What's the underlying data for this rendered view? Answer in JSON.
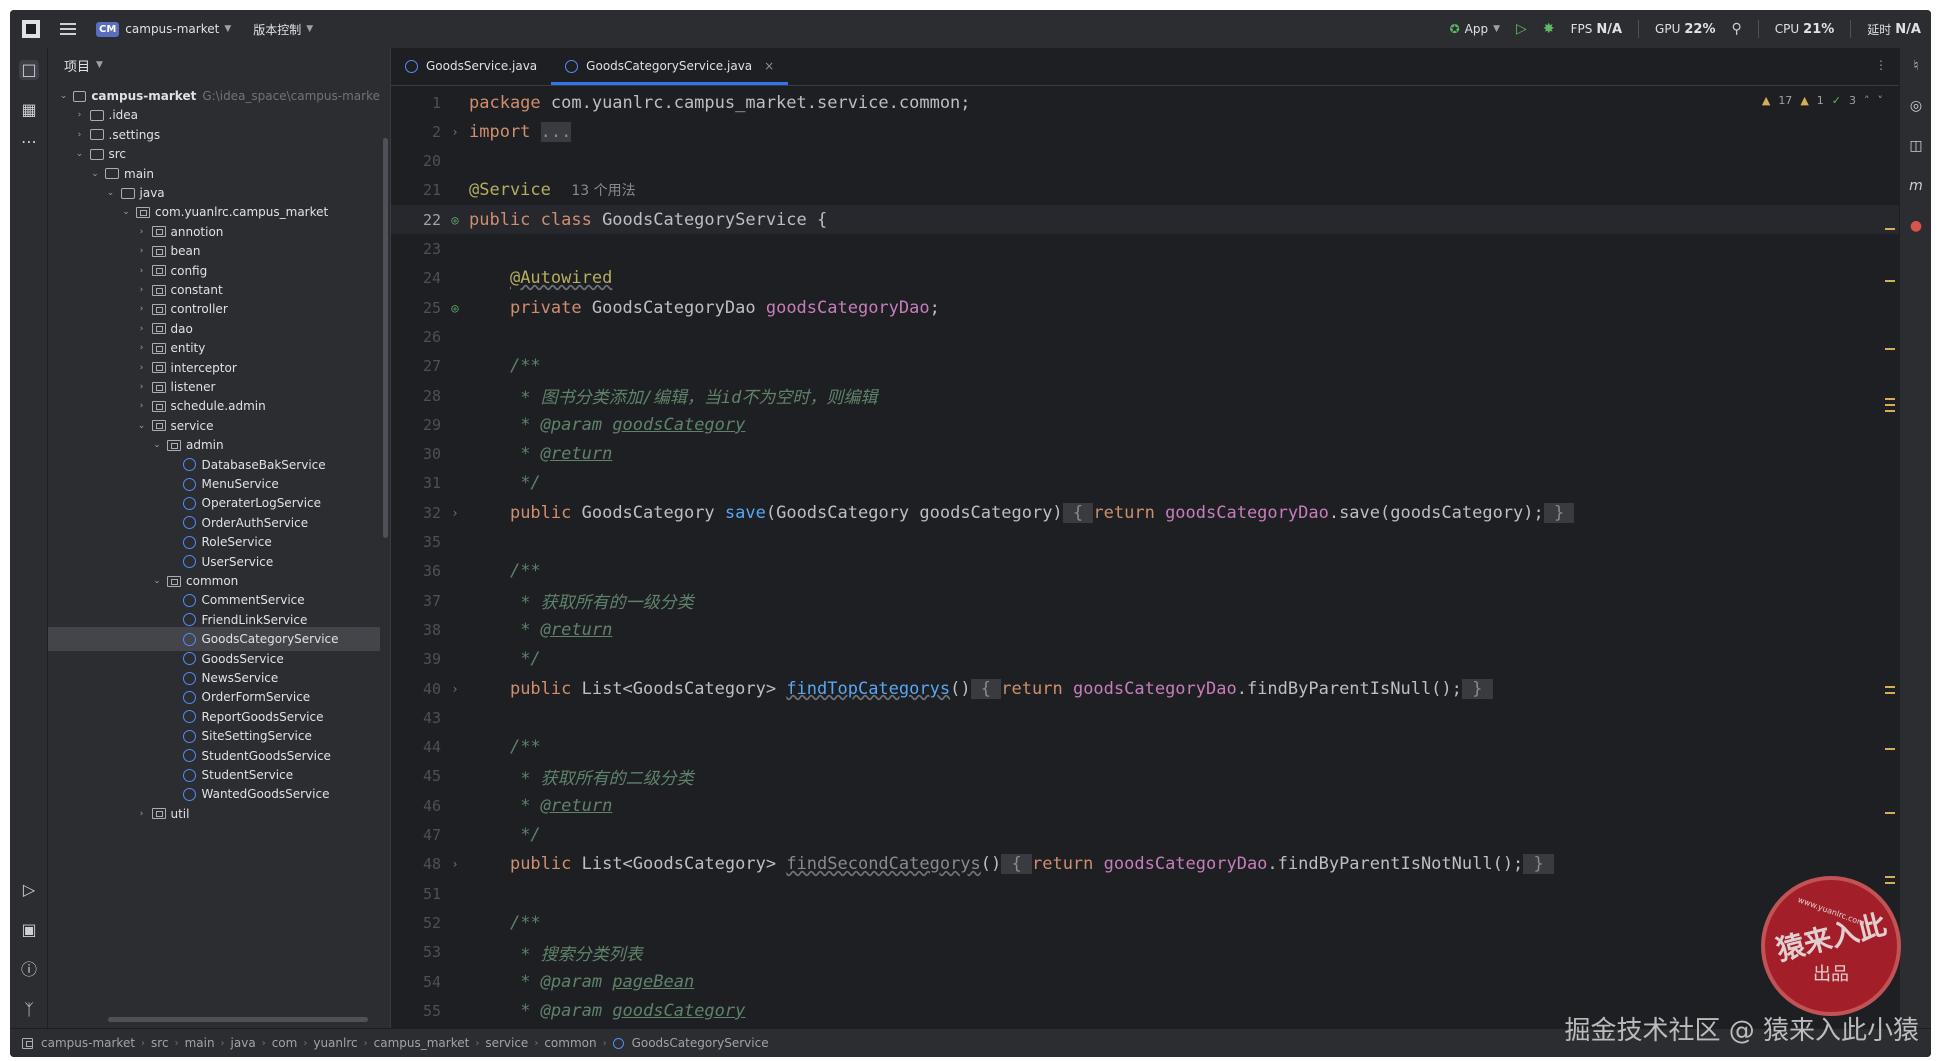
{
  "titlebar": {
    "project_badge": "CM",
    "project_name": "campus-market",
    "vcs": "版本控制",
    "run_config": "App",
    "fps_label": "FPS",
    "fps_value": "N/A",
    "gpu_label": "GPU",
    "gpu_value": "22%",
    "cpu_label": "CPU",
    "cpu_value": "21%",
    "time_label": "延时",
    "time_value": "N/A"
  },
  "project_panel": {
    "header": "项目",
    "root_path": "G:\\idea_space\\campus-marke",
    "tree": [
      {
        "label": "campus-market",
        "depth": 0,
        "type": "module",
        "arrow": "down",
        "bold": true
      },
      {
        "label": ".idea",
        "depth": 1,
        "type": "folder",
        "arrow": "right"
      },
      {
        "label": ".settings",
        "depth": 1,
        "type": "folder",
        "arrow": "right"
      },
      {
        "label": "src",
        "depth": 1,
        "type": "folder",
        "arrow": "down"
      },
      {
        "label": "main",
        "depth": 2,
        "type": "folder",
        "arrow": "down"
      },
      {
        "label": "java",
        "depth": 3,
        "type": "folder",
        "arrow": "down"
      },
      {
        "label": "com.yuanlrc.campus_market",
        "depth": 4,
        "type": "pkg",
        "arrow": "down"
      },
      {
        "label": "annotion",
        "depth": 5,
        "type": "pkg",
        "arrow": "right"
      },
      {
        "label": "bean",
        "depth": 5,
        "type": "pkg",
        "arrow": "right"
      },
      {
        "label": "config",
        "depth": 5,
        "type": "pkg",
        "arrow": "right"
      },
      {
        "label": "constant",
        "depth": 5,
        "type": "pkg",
        "arrow": "right"
      },
      {
        "label": "controller",
        "depth": 5,
        "type": "pkg",
        "arrow": "right"
      },
      {
        "label": "dao",
        "depth": 5,
        "type": "pkg",
        "arrow": "right"
      },
      {
        "label": "entity",
        "depth": 5,
        "type": "pkg",
        "arrow": "right"
      },
      {
        "label": "interceptor",
        "depth": 5,
        "type": "pkg",
        "arrow": "right"
      },
      {
        "label": "listener",
        "depth": 5,
        "type": "pkg",
        "arrow": "right"
      },
      {
        "label": "schedule.admin",
        "depth": 5,
        "type": "pkg",
        "arrow": "right"
      },
      {
        "label": "service",
        "depth": 5,
        "type": "pkg",
        "arrow": "down"
      },
      {
        "label": "admin",
        "depth": 6,
        "type": "pkg",
        "arrow": "down"
      },
      {
        "label": "DatabaseBakService",
        "depth": 7,
        "type": "class"
      },
      {
        "label": "MenuService",
        "depth": 7,
        "type": "class"
      },
      {
        "label": "OperaterLogService",
        "depth": 7,
        "type": "class"
      },
      {
        "label": "OrderAuthService",
        "depth": 7,
        "type": "class"
      },
      {
        "label": "RoleService",
        "depth": 7,
        "type": "class"
      },
      {
        "label": "UserService",
        "depth": 7,
        "type": "class"
      },
      {
        "label": "common",
        "depth": 6,
        "type": "pkg",
        "arrow": "down"
      },
      {
        "label": "CommentService",
        "depth": 7,
        "type": "class"
      },
      {
        "label": "FriendLinkService",
        "depth": 7,
        "type": "class"
      },
      {
        "label": "GoodsCategoryService",
        "depth": 7,
        "type": "class",
        "selected": true
      },
      {
        "label": "GoodsService",
        "depth": 7,
        "type": "class"
      },
      {
        "label": "NewsService",
        "depth": 7,
        "type": "class"
      },
      {
        "label": "OrderFormService",
        "depth": 7,
        "type": "class"
      },
      {
        "label": "ReportGoodsService",
        "depth": 7,
        "type": "class"
      },
      {
        "label": "SiteSettingService",
        "depth": 7,
        "type": "class"
      },
      {
        "label": "StudentGoodsService",
        "depth": 7,
        "type": "class"
      },
      {
        "label": "StudentService",
        "depth": 7,
        "type": "class"
      },
      {
        "label": "WantedGoodsService",
        "depth": 7,
        "type": "class"
      },
      {
        "label": "util",
        "depth": 5,
        "type": "pkg",
        "arrow": "right"
      }
    ]
  },
  "tabs": [
    {
      "label": "GoodsService.java",
      "active": false
    },
    {
      "label": "GoodsCategoryService.java",
      "active": true
    }
  ],
  "inspections": {
    "warnings": "17",
    "weak": "1",
    "ok": "3"
  },
  "code_lines": [
    {
      "n": "1",
      "html": "<span class='kw'>package</span> com.yuanlrc.campus_market.service.common;"
    },
    {
      "n": "2",
      "html": "<span class='kw'>import</span> <span class='fold'>...</span>",
      "fold": true
    },
    {
      "n": "20",
      "html": ""
    },
    {
      "n": "21",
      "html": "<span class='ann'>@Service</span>  <span class='usage'>13 个用法</span>"
    },
    {
      "n": "22",
      "html": "<span class='kw'>public class</span> GoodsCategoryService {",
      "cur": true,
      "bean": true
    },
    {
      "n": "23",
      "html": ""
    },
    {
      "n": "24",
      "html": "    <span class='ann ul'>@Autowired</span>"
    },
    {
      "n": "25",
      "html": "    <span class='kw'>private</span> GoodsCategoryDao <span class='fld'>goodsCategoryDao</span>;",
      "bean": true
    },
    {
      "n": "26",
      "html": ""
    },
    {
      "n": "27",
      "html": "    <span class='cmt'>/**</span>"
    },
    {
      "n": "28",
      "html": "     <span class='cmt'>* 图书分类添加/编辑，当id不为空时，则编辑</span>"
    },
    {
      "n": "29",
      "html": "     <span class='cmt'>* @param <span class='tag'>goodsCategory</span></span>"
    },
    {
      "n": "30",
      "html": "     <span class='cmt'>* <span class='tag'>@return</span></span>"
    },
    {
      "n": "31",
      "html": "     <span class='cmt'>*/</span>"
    },
    {
      "n": "32",
      "html": "    <span class='kw'>public</span> GoodsCategory <span class='mth'>save</span>(GoodsCategory goodsCategory)<span class='fold'> { </span><span class='kw'>return</span> <span class='fld'>goodsCategoryDao</span>.save(goodsCategory);<span class='fold'> } </span>",
      "fold": true
    },
    {
      "n": "35",
      "html": ""
    },
    {
      "n": "36",
      "html": "    <span class='cmt'>/**</span>"
    },
    {
      "n": "37",
      "html": "     <span class='cmt'>* 获取所有的一级分类</span>"
    },
    {
      "n": "38",
      "html": "     <span class='cmt'>* <span class='tag'>@return</span></span>"
    },
    {
      "n": "39",
      "html": "     <span class='cmt'>*/</span>"
    },
    {
      "n": "40",
      "html": "    <span class='kw'>public</span> List&lt;GoodsCategory&gt; <span class='mth ul'>findTopCategorys</span>()<span class='fold'> { </span><span class='kw'>return</span> <span class='fld'>goodsCategoryDao</span>.findByParentIsNull();<span class='fold'> } </span>",
      "fold": true
    },
    {
      "n": "43",
      "html": ""
    },
    {
      "n": "44",
      "html": "    <span class='cmt'>/**</span>"
    },
    {
      "n": "45",
      "html": "     <span class='cmt'>* 获取所有的二级分类</span>"
    },
    {
      "n": "46",
      "html": "     <span class='cmt'>* <span class='tag'>@return</span></span>"
    },
    {
      "n": "47",
      "html": "     <span class='cmt'>*/</span>"
    },
    {
      "n": "48",
      "html": "    <span class='kw'>public</span> List&lt;GoodsCategory&gt; <span class='grey ul'>findSecondCategorys</span>()<span class='fold'> { </span><span class='kw'>return</span> <span class='fld'>goodsCategoryDao</span>.findByParentIsNotNull();<span class='fold'> } </span>",
      "fold": true
    },
    {
      "n": "51",
      "html": ""
    },
    {
      "n": "52",
      "html": "    <span class='cmt'>/**</span>"
    },
    {
      "n": "53",
      "html": "     <span class='cmt'>* 搜索分类列表</span>"
    },
    {
      "n": "54",
      "html": "     <span class='cmt'>* @param <span class='tag'>pageBean</span></span>"
    },
    {
      "n": "55",
      "html": "     <span class='cmt'>* @param <span class='tag'>goodsCategory</span></span>"
    }
  ],
  "statusbar": [
    "campus-market",
    "src",
    "main",
    "java",
    "com",
    "yuanlrc",
    "campus_market",
    "service",
    "common",
    "GoodsCategoryService"
  ],
  "watermark": {
    "stamp_main": "猿来入此",
    "stamp_sub": "出品",
    "stamp_url": "www.yuanlrc.com",
    "csdn": "掘金技术社区 @ 猿来入此小猿"
  }
}
